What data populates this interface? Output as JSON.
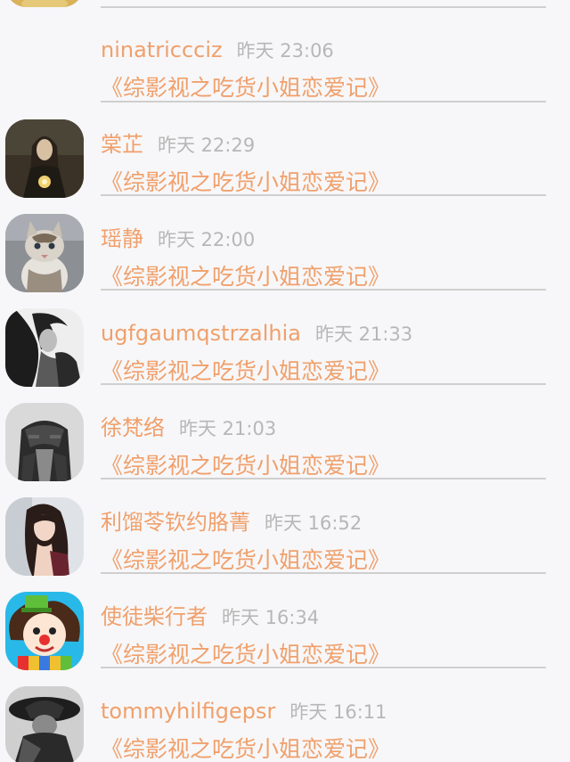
{
  "list": {
    "items": [
      {
        "name": "ninatriccciz",
        "time": "昨天 23:06",
        "title": "《综影视之吃货小姐恋爱记》",
        "avatar": "none"
      },
      {
        "name": "棠芷",
        "time": "昨天 22:29",
        "title": "《综影视之吃货小姐恋爱记》",
        "avatar": "dark-portrait-avatar"
      },
      {
        "name": "瑶静",
        "time": "昨天 22:00",
        "title": "《综影视之吃货小姐恋爱记》",
        "avatar": "kitten-avatar"
      },
      {
        "name": "ugfgaumqstrzalhia",
        "time": "昨天 21:33",
        "title": "《综影视之吃货小姐恋爱记》",
        "avatar": "bw-woman-avatar"
      },
      {
        "name": "徐梵络",
        "time": "昨天 21:03",
        "title": "《综影视之吃货小姐恋爱记》",
        "avatar": "leather-jacket-avatar"
      },
      {
        "name": "利馏苓钦约胳菁",
        "time": "昨天 16:52",
        "title": "《综影视之吃货小姐恋爱记》",
        "avatar": "girl-photo-avatar"
      },
      {
        "name": "使徒柴行者",
        "time": "昨天 16:34",
        "title": "《综影视之吃货小姐恋爱记》",
        "avatar": "clown-cartoon-avatar"
      },
      {
        "name": "tommyhilfigepsr",
        "time": "昨天 16:11",
        "title": "《综影视之吃货小姐恋爱记》",
        "avatar": "bw-hat-avatar"
      }
    ]
  }
}
